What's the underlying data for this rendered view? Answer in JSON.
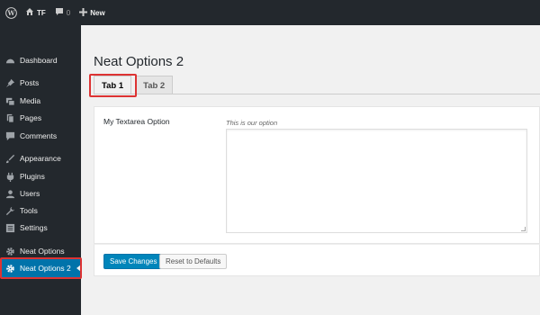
{
  "adminbar": {
    "site_name": "TF",
    "comments_count": "0",
    "new_label": "New"
  },
  "sidebar": {
    "items": [
      {
        "label": "Dashboard",
        "icon": "dashboard-icon"
      },
      {
        "label": "Posts",
        "icon": "pin-icon"
      },
      {
        "label": "Media",
        "icon": "media-icon"
      },
      {
        "label": "Pages",
        "icon": "pages-icon"
      },
      {
        "label": "Comments",
        "icon": "comment-icon"
      },
      {
        "label": "Appearance",
        "icon": "brush-icon"
      },
      {
        "label": "Plugins",
        "icon": "plugin-icon"
      },
      {
        "label": "Users",
        "icon": "user-icon"
      },
      {
        "label": "Tools",
        "icon": "wrench-icon"
      },
      {
        "label": "Settings",
        "icon": "settings-icon"
      },
      {
        "label": "Neat Options",
        "icon": "gear-icon"
      },
      {
        "label": "Neat Options 2",
        "icon": "gear-icon"
      }
    ],
    "active_item": "Neat Options 2"
  },
  "main": {
    "title": "Neat Options 2",
    "tabs": [
      {
        "label": "Tab 1"
      },
      {
        "label": "Tab 2"
      }
    ],
    "active_tab": "Tab 1",
    "field": {
      "label": "My Textarea Option",
      "description": "This is our option",
      "value": ""
    },
    "buttons": {
      "save_label": "Save Changes",
      "reset_label": "Reset to Defaults"
    }
  },
  "colors": {
    "accent": "#0073aa",
    "highlight_border": "#dd3333",
    "admin_bg": "#23282d"
  }
}
